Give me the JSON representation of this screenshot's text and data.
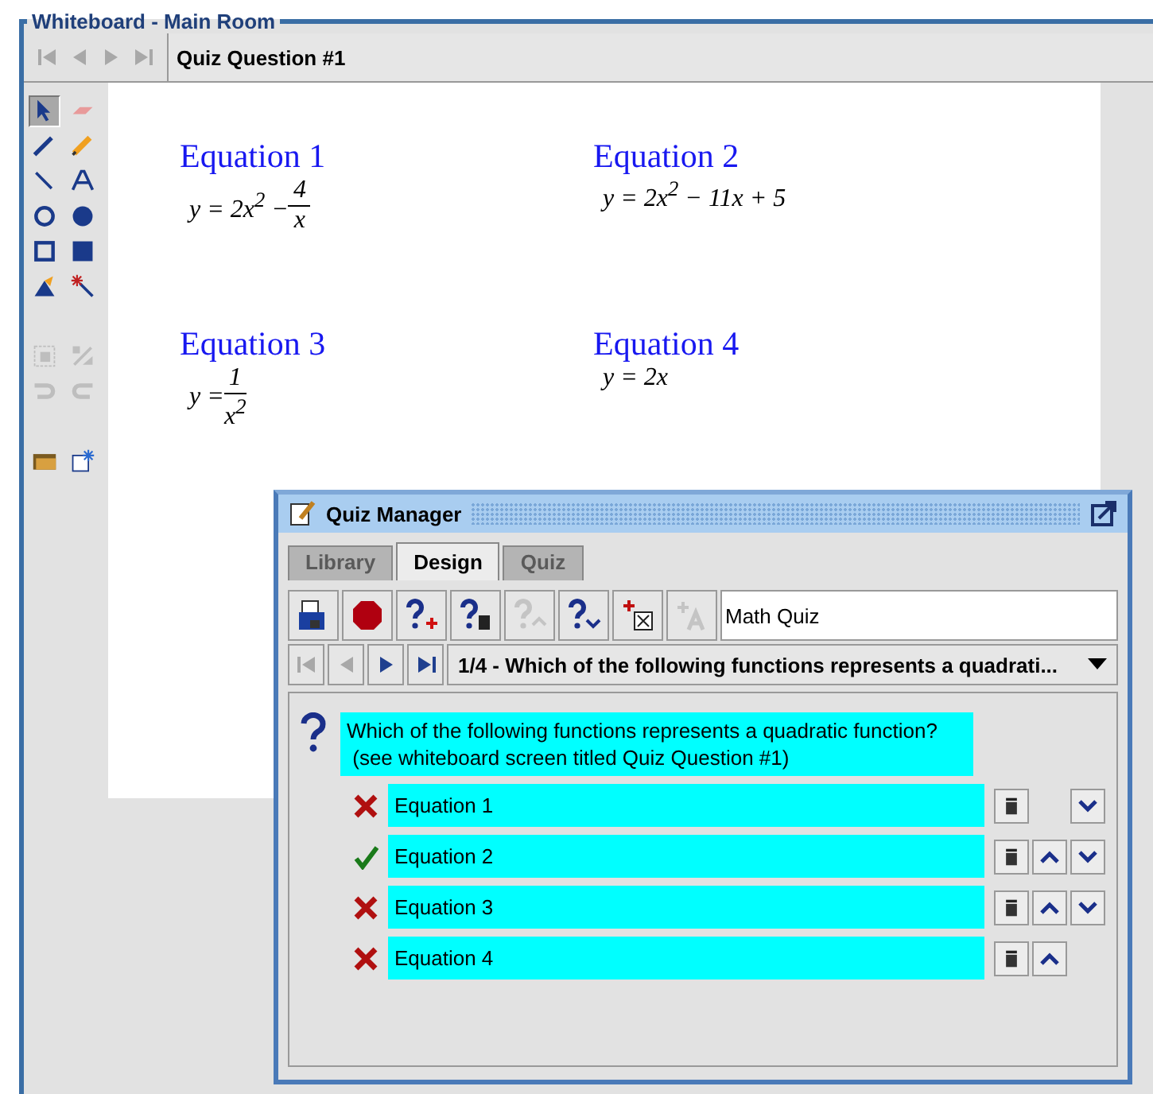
{
  "whiteboard": {
    "title": "Whiteboard - Main Room",
    "nav_buttons": [
      {
        "kind": "first",
        "disabled": true
      },
      {
        "kind": "prev",
        "disabled": true
      },
      {
        "kind": "next",
        "disabled": true
      },
      {
        "kind": "last",
        "disabled": true
      }
    ],
    "screen_title": "Quiz Question #1",
    "tools": [
      {
        "kind": "pointer",
        "selected": true,
        "disabled": false
      },
      {
        "kind": "eraser",
        "selected": false,
        "disabled": false
      },
      {
        "kind": "pen",
        "selected": false,
        "disabled": false
      },
      {
        "kind": "highlighter",
        "selected": false,
        "disabled": false
      },
      {
        "kind": "line",
        "selected": false,
        "disabled": false
      },
      {
        "kind": "text",
        "selected": false,
        "disabled": false
      },
      {
        "kind": "circle",
        "selected": false,
        "disabled": false
      },
      {
        "kind": "disc",
        "selected": false,
        "disabled": false
      },
      {
        "kind": "square",
        "selected": false,
        "disabled": false
      },
      {
        "kind": "filled-square",
        "selected": false,
        "disabled": false
      },
      {
        "kind": "fill",
        "selected": false,
        "disabled": false
      },
      {
        "kind": "wand",
        "selected": false,
        "disabled": false
      },
      {
        "kind": "gap"
      },
      {
        "kind": "gap"
      },
      {
        "kind": "select-area",
        "selected": false,
        "disabled": true
      },
      {
        "kind": "cut",
        "selected": false,
        "disabled": true
      },
      {
        "kind": "undo",
        "selected": false,
        "disabled": true
      },
      {
        "kind": "redo",
        "selected": false,
        "disabled": true
      },
      {
        "kind": "gap"
      },
      {
        "kind": "gap"
      },
      {
        "kind": "folder",
        "selected": false,
        "disabled": false
      },
      {
        "kind": "new",
        "selected": false,
        "disabled": false
      }
    ],
    "equations": [
      {
        "label": "Equation 1",
        "parts": [
          {
            "kind": "text",
            "text": "y = 2x$^{2}$ − "
          },
          {
            "kind": "fraction",
            "numerator": "4",
            "denominator": "x"
          }
        ]
      },
      {
        "label": "Equation 2",
        "parts": [
          {
            "kind": "text",
            "text": "y = 2x$^{2}$ − 11x + 5"
          }
        ]
      },
      {
        "label": "Equation 3",
        "parts": [
          {
            "kind": "text",
            "text": "y = "
          },
          {
            "kind": "fraction",
            "numerator": "1",
            "denominator": "x$^{2}$"
          }
        ]
      },
      {
        "label": "Equation 4",
        "parts": [
          {
            "kind": "text",
            "text": "y = 2x"
          }
        ]
      }
    ]
  },
  "quiz_manager": {
    "title": "Quiz Manager",
    "tabs": [
      {
        "label": "Library",
        "selected": false,
        "disabled": true
      },
      {
        "label": "Design",
        "selected": true,
        "disabled": false
      },
      {
        "label": "Quiz",
        "selected": false,
        "disabled": true
      }
    ],
    "toolbar": [
      {
        "kind": "save",
        "disabled": false
      },
      {
        "kind": "stop",
        "disabled": false
      },
      {
        "kind": "add-question",
        "disabled": false
      },
      {
        "kind": "delete-question",
        "disabled": false
      },
      {
        "kind": "question-up",
        "disabled": true
      },
      {
        "kind": "question-down",
        "disabled": false
      },
      {
        "kind": "add-answer",
        "disabled": false
      },
      {
        "kind": "add-text",
        "disabled": true
      }
    ],
    "quiz_name": "Math Quiz",
    "nav_buttons": [
      {
        "kind": "first",
        "disabled": true
      },
      {
        "kind": "prev",
        "disabled": true
      },
      {
        "kind": "next",
        "disabled": false
      },
      {
        "kind": "last",
        "disabled": false
      }
    ],
    "question_select": "1/4 - Which of the following functions represents a quadrati...",
    "question_lines": [
      "Which of the following functions represents a quadratic function?",
      " (see whiteboard screen titled Quiz Question #1)"
    ],
    "answers": [
      {
        "text": "Equation 1",
        "correct": false,
        "can_move_up": false,
        "can_move_down": true
      },
      {
        "text": "Equation 2",
        "correct": true,
        "can_move_up": true,
        "can_move_down": true
      },
      {
        "text": "Equation 3",
        "correct": false,
        "can_move_up": true,
        "can_move_down": true
      },
      {
        "text": "Equation 4",
        "correct": false,
        "can_move_up": true,
        "can_move_down": false
      }
    ]
  }
}
